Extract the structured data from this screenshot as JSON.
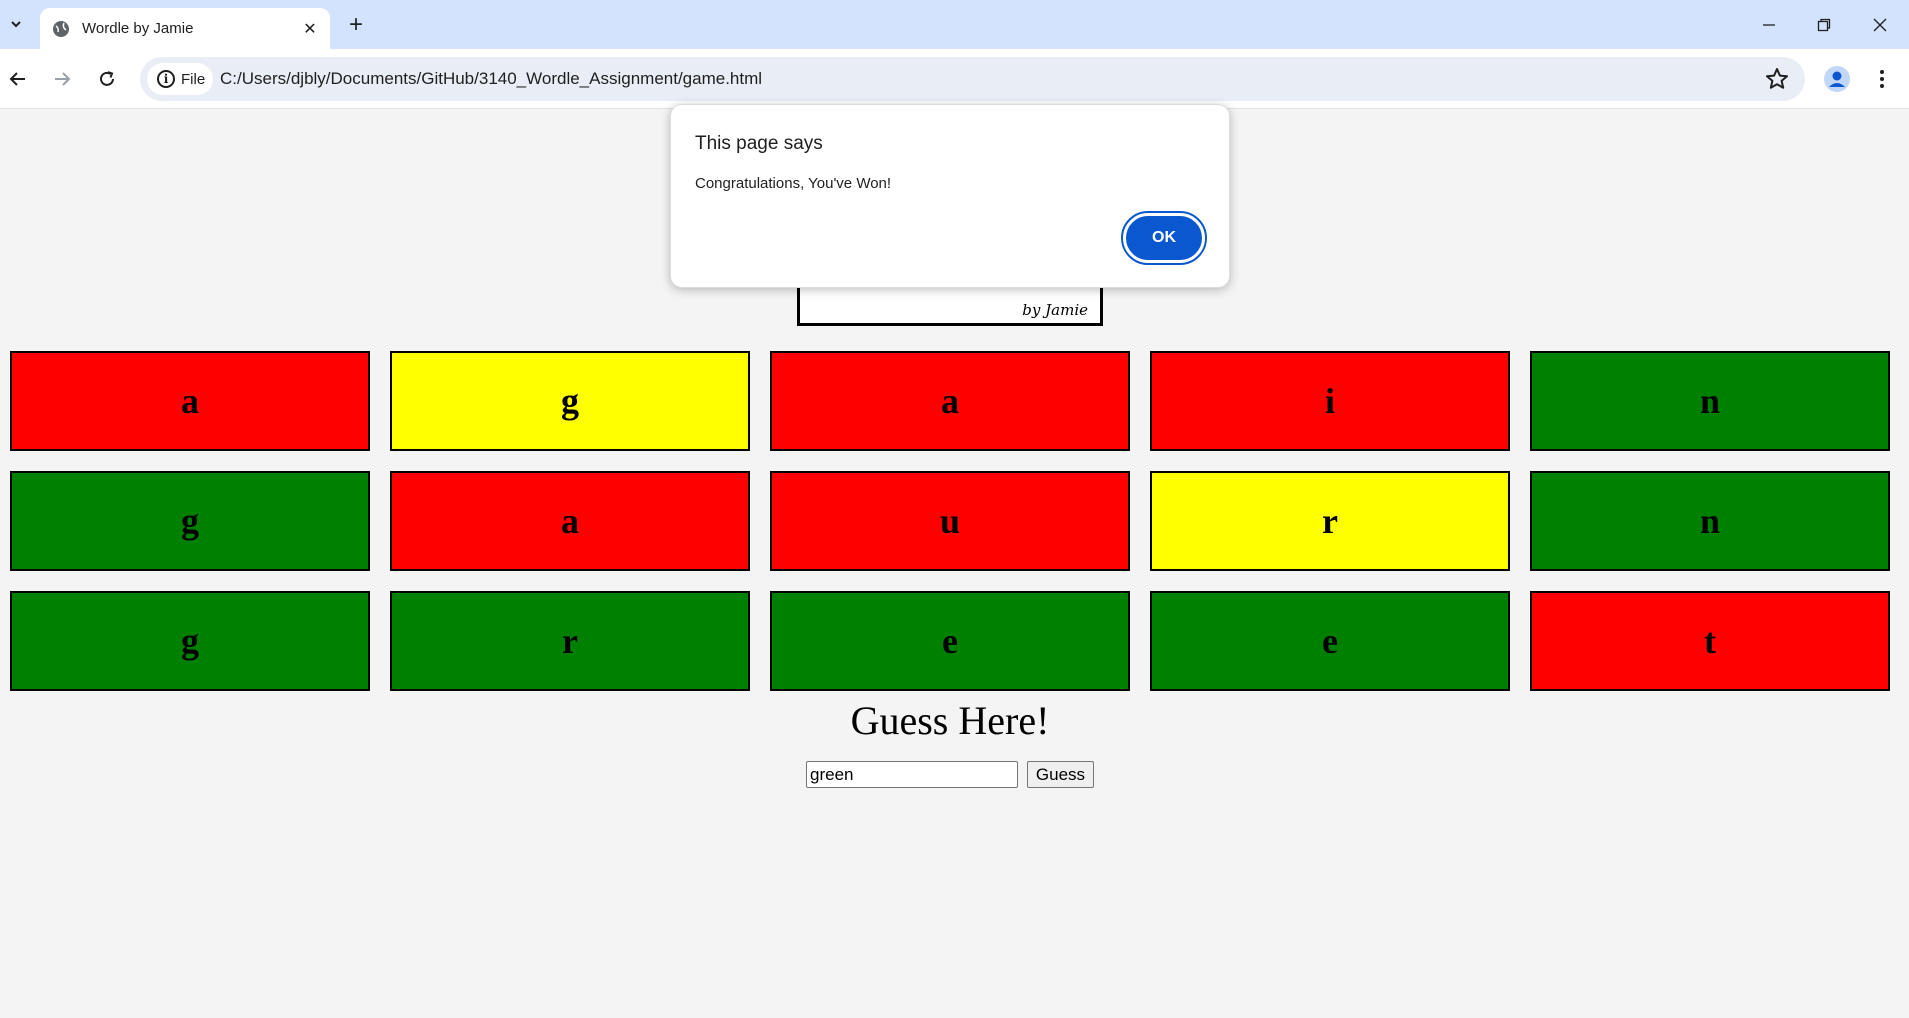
{
  "browser": {
    "tab_title": "Wordle by Jamie",
    "file_chip": "File",
    "url": "C:/Users/djbly/Documents/GitHub/3140_Wordle_Assignment/game.html"
  },
  "logo": {
    "byline": "by Jamie"
  },
  "board": {
    "colors": {
      "red": "#ff0000",
      "yellow": "#ffff00",
      "green": "#008000"
    },
    "rows": [
      [
        {
          "letter": "a",
          "state": "red"
        },
        {
          "letter": "g",
          "state": "yellow"
        },
        {
          "letter": "a",
          "state": "red"
        },
        {
          "letter": "i",
          "state": "red"
        },
        {
          "letter": "n",
          "state": "green"
        }
      ],
      [
        {
          "letter": "g",
          "state": "green"
        },
        {
          "letter": "a",
          "state": "red"
        },
        {
          "letter": "u",
          "state": "red"
        },
        {
          "letter": "r",
          "state": "yellow"
        },
        {
          "letter": "n",
          "state": "green"
        }
      ],
      [
        {
          "letter": "g",
          "state": "green"
        },
        {
          "letter": "r",
          "state": "green"
        },
        {
          "letter": "e",
          "state": "green"
        },
        {
          "letter": "e",
          "state": "green"
        },
        {
          "letter": "t",
          "state": "red"
        }
      ]
    ]
  },
  "guess": {
    "title": "Guess Here!",
    "input_value": "green",
    "button_label": "Guess"
  },
  "dialog": {
    "heading": "This page says",
    "message": "Congratulations, You've Won!",
    "ok_label": "OK"
  }
}
